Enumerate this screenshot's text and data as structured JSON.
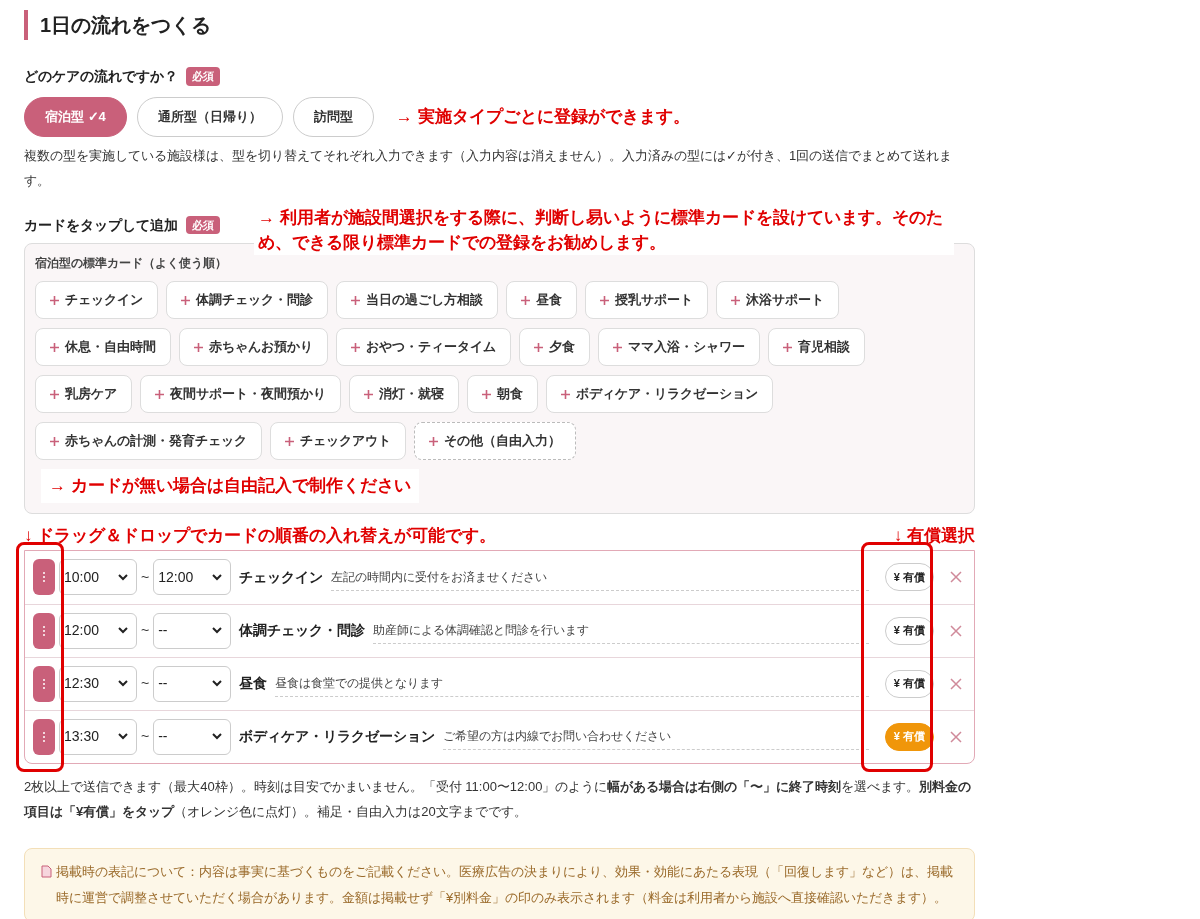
{
  "heading": "1日の流れをつくる",
  "type_question": {
    "label": "どのケアの流れですか？",
    "badge": "必須"
  },
  "types": [
    {
      "label": "宿泊型 ✓4",
      "selected": true
    },
    {
      "label": "通所型（日帰り）",
      "selected": false
    },
    {
      "label": "訪問型",
      "selected": false
    }
  ],
  "type_description": "複数の型を実施している施設様は、型を切り替えてそれぞれ入力できます（入力内容は消えません）。入力済みの型には✓が付き、1回の送信でまとめて送れます。",
  "cards_question": {
    "label": "カードをタップして追加",
    "badge": "必須"
  },
  "card_panel": {
    "title": "宿泊型の標準カード（よく使う順）",
    "cards": [
      {
        "label": "チェックイン",
        "kind": "standard"
      },
      {
        "label": "体調チェック・問診",
        "kind": "standard"
      },
      {
        "label": "当日の過ごし方相談",
        "kind": "standard"
      },
      {
        "label": "昼食",
        "kind": "standard"
      },
      {
        "label": "授乳サポート",
        "kind": "standard"
      },
      {
        "label": "沐浴サポート",
        "kind": "standard"
      },
      {
        "label": "休息・自由時間",
        "kind": "standard"
      },
      {
        "label": "赤ちゃんお預かり",
        "kind": "standard"
      },
      {
        "label": "おやつ・ティータイム",
        "kind": "standard"
      },
      {
        "label": "夕食",
        "kind": "standard"
      },
      {
        "label": "ママ入浴・シャワー",
        "kind": "standard"
      },
      {
        "label": "育児相談",
        "kind": "standard"
      },
      {
        "label": "乳房ケア",
        "kind": "standard"
      },
      {
        "label": "夜間サポート・夜間預かり",
        "kind": "standard"
      },
      {
        "label": "消灯・就寝",
        "kind": "standard"
      },
      {
        "label": "朝食",
        "kind": "standard"
      },
      {
        "label": "ボディケア・リラクゼーション",
        "kind": "standard"
      },
      {
        "label": "赤ちゃんの計測・発育チェック",
        "kind": "standard"
      },
      {
        "label": "チェックアウト",
        "kind": "standard"
      },
      {
        "label": "その他（自由入力）",
        "kind": "custom"
      }
    ]
  },
  "schedule": [
    {
      "start": "10:00",
      "end": "12:00",
      "title": "チェックイン",
      "note": "左記の時間内に受付をお済ませください",
      "paid_label": "¥ 有償",
      "paid": false
    },
    {
      "start": "12:00",
      "end": "--",
      "title": "体調チェック・問診",
      "note": "助産師による体調確認と問診を行います",
      "paid_label": "¥ 有償",
      "paid": false
    },
    {
      "start": "12:30",
      "end": "--",
      "title": "昼食",
      "note": "昼食は食堂での提供となります",
      "paid_label": "¥ 有償",
      "paid": false
    },
    {
      "start": "13:30",
      "end": "--",
      "title": "ボディケア・リラクゼーション",
      "note": "ご希望の方は内線でお問い合わせください",
      "paid_label": "¥ 有償",
      "paid": true
    }
  ],
  "range_separator": "~",
  "schedule_help": "2枚以上で送信できます（最大40枠）。時刻は目安でかまいません。「受付 11:00〜12:00」のように**幅がある場合は右側の「〜」に終了時刻**を選べます。**別料金の項目は「¥有償」をタップ**（オレンジ色に点灯）。補足・自由入力は20文字までです。",
  "notice": "掲載時の表記について：内容は事実に基づくものをご記載ください。医療広告の決まりにより、効果・効能にあたる表現（「回復します」など）は、掲載時に運営で調整させていただく場合があります。金額は掲載せず「¥別料金」の印のみ表示されます（料金は利用者から施設へ直接確認いただきます）。",
  "annotations": {
    "types": "→ 実施タイプごとに登録ができます。",
    "cards": "→ 利用者が施設間選択をする際に、判断し易いように標準カードを設けています。そのため、できる限り標準カードでの登録をお勧めします。",
    "custom": "→ カードが無い場合は自由記入で制作ください",
    "drag": "↓ ドラッグ＆ドロップでカードの順番の入れ替えが可能です。",
    "paid": "↓ 有償選択"
  }
}
